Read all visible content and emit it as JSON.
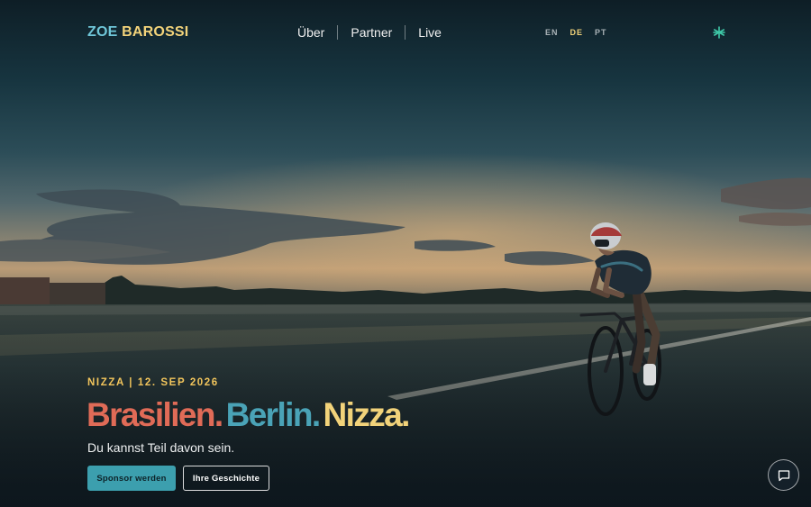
{
  "nav": {
    "logo": {
      "part1": "ZOE",
      "part2": "BAROSSI"
    },
    "menu": [
      {
        "label": "Über"
      },
      {
        "label": "Partner"
      },
      {
        "label": "Live"
      }
    ],
    "languages": [
      {
        "label": "EN",
        "active": false
      },
      {
        "label": "DE",
        "active": true
      },
      {
        "label": "PT",
        "active": false
      }
    ],
    "social_icon": "asterisk-social-icon"
  },
  "hero": {
    "eyebrow": "NIZZA | 12. SEP 2026",
    "headline": {
      "word1": "Brasilien.",
      "word2": "Berlin.",
      "word3": "Nizza."
    },
    "subline": "Du kannst Teil davon sein.",
    "primary_button": "Sponsor werden",
    "secondary_button": "Ihre Geschichte",
    "background_image": "cyclist-on-airfield-sunset"
  },
  "chat": {
    "icon": "chat-bubble-icon"
  },
  "colors": {
    "brand_teal": "#4aa3b7",
    "brand_yellow": "#f2d37a",
    "brand_coral": "#e06b57",
    "eyebrow": "#f2c55c",
    "button_primary": "#3c9fae"
  }
}
